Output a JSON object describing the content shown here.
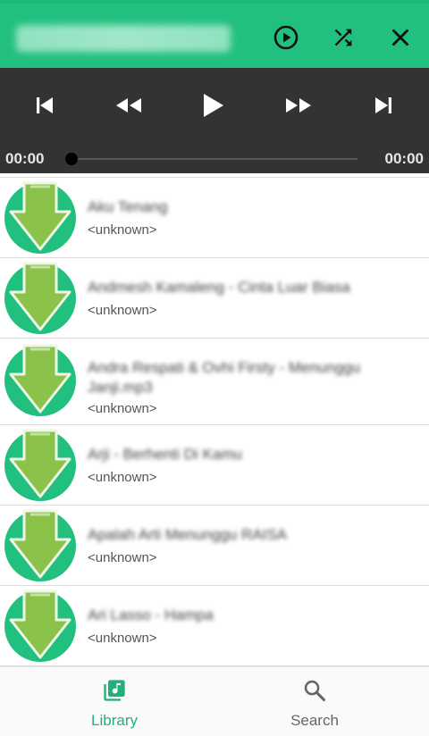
{
  "header": {
    "title": ""
  },
  "player": {
    "elapsed": "00:00",
    "duration": "00:00",
    "progress": 0
  },
  "songs": [
    {
      "title": "Aku Tenang",
      "artist": "<unknown>"
    },
    {
      "title": "Andmesh Kamaleng - Cinta Luar Biasa",
      "artist": "<unknown>"
    },
    {
      "title": "Andra Respati & Ovhi Firsty - Menunggu Janji.mp3",
      "artist": "<unknown>"
    },
    {
      "title": "Arji - Berhenti Di Kamu",
      "artist": "<unknown>"
    },
    {
      "title": "Apalah Arti Menunggu RAISA",
      "artist": "<unknown>"
    },
    {
      "title": "Ari Lasso - Hampa",
      "artist": "<unknown>"
    }
  ],
  "nav": {
    "library_label": "Library",
    "search_label": "Search"
  },
  "colors": {
    "accent": "#22c07f",
    "player_bg": "#333333",
    "arrow": "#8bc34a"
  }
}
